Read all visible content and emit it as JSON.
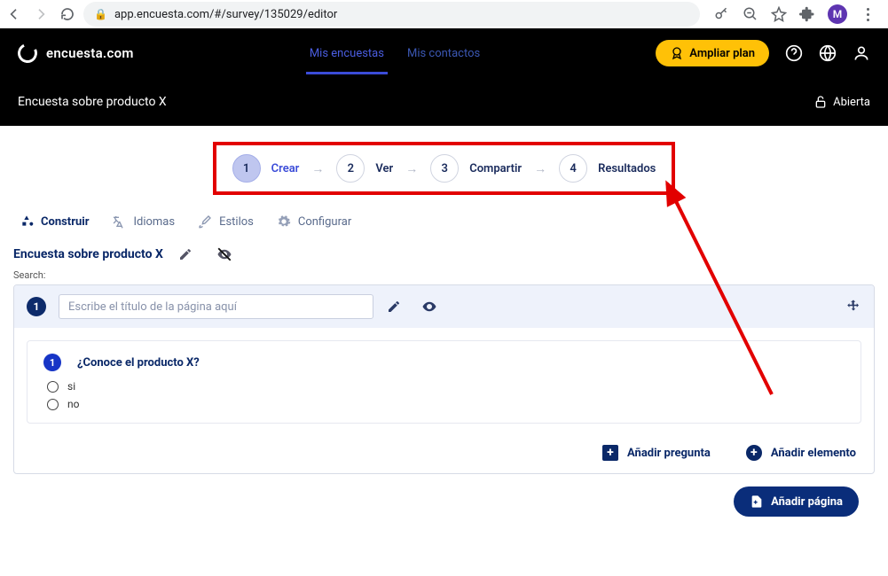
{
  "browser": {
    "url": "app.encuesta.com/#/survey/135029/editor",
    "avatar_initial": "M"
  },
  "header": {
    "brand": "encuesta.com",
    "nav": {
      "surveys": "Mis encuestas",
      "contacts": "Mis contactos"
    },
    "upgrade": "Ampliar plan",
    "survey_title": "Encuesta sobre producto X",
    "status": "Abierta"
  },
  "stepper": {
    "s1": {
      "n": "1",
      "label": "Crear"
    },
    "s2": {
      "n": "2",
      "label": "Ver"
    },
    "s3": {
      "n": "3",
      "label": "Compartir"
    },
    "s4": {
      "n": "4",
      "label": "Resultados"
    }
  },
  "tabs": {
    "build": "Construir",
    "languages": "Idiomas",
    "styles": "Estilos",
    "configure": "Configurar"
  },
  "editor": {
    "survey_title": "Encuesta sobre producto X",
    "search_label": "Search:",
    "page": {
      "number": "1",
      "title_placeholder": "Escribe el título de la página aquí"
    },
    "question": {
      "number": "1",
      "text": "¿Conoce el producto X?",
      "answers": {
        "a1": "si",
        "a2": "no"
      }
    },
    "footer": {
      "add_question": "Añadir pregunta",
      "add_element": "Añadir elemento"
    },
    "add_page": "Añadir página"
  }
}
